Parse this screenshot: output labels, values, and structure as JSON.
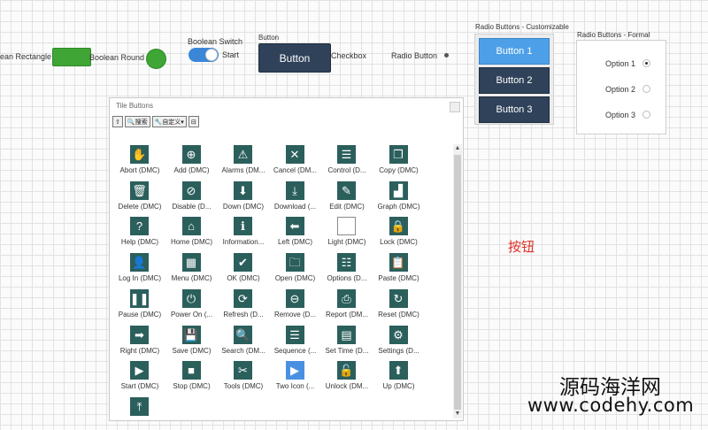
{
  "controls": {
    "boolean_rectangle_label": "ean Rectangle",
    "boolean_round_label": "Boolean Round",
    "boolean_switch_label": "Boolean Switch",
    "boolean_switch_text": "Start",
    "button_caption": "Button",
    "button_label": "Button",
    "checkbox_label": "Checkbox",
    "radio_button_label": "Radio Button"
  },
  "custom_radio": {
    "title": "Radio Buttons - Customizable",
    "options": [
      "Button 1",
      "Button 2",
      "Button 3"
    ],
    "selected_index": 0,
    "colors": {
      "selected": "#4da0e8",
      "normal": "#2f4259"
    }
  },
  "formal_radio": {
    "title": "Radio Buttons - Formal",
    "options": [
      "Option 1",
      "Option 2",
      "Option 3"
    ],
    "selected_index": 0
  },
  "tile_buttons": {
    "title": "Tile Buttons",
    "toolbar": {
      "up": "⇧",
      "search": "搜索",
      "custom": "自定义▾",
      "view": "⊟"
    },
    "tiles": [
      {
        "label": "Abort (DMC)",
        "icon": "hand-icon",
        "glyph": "✋"
      },
      {
        "label": "Add (DMC)",
        "icon": "add-icon",
        "glyph": "⊕"
      },
      {
        "label": "Alarms (DM...",
        "icon": "warning-icon",
        "glyph": "⚠"
      },
      {
        "label": "Cancel (DM...",
        "icon": "close-icon",
        "glyph": "✕"
      },
      {
        "label": "Control (D...",
        "icon": "sliders-icon",
        "glyph": "☰"
      },
      {
        "label": "Copy (DMC)",
        "icon": "copy-icon",
        "glyph": "❐"
      },
      {
        "label": "Delete (DMC)",
        "icon": "trash-icon",
        "glyph": "🗑"
      },
      {
        "label": "Disable (D...",
        "icon": "disable-icon",
        "glyph": "⊘"
      },
      {
        "label": "Down (DMC)",
        "icon": "arrow-down-icon",
        "glyph": "⬇"
      },
      {
        "label": "Download (...",
        "icon": "download-icon",
        "glyph": "⤓"
      },
      {
        "label": "Edit (DMC)",
        "icon": "pencil-icon",
        "glyph": "✎"
      },
      {
        "label": "Graph (DMC)",
        "icon": "bar-chart-icon",
        "glyph": "▟"
      },
      {
        "label": "Help (DMC)",
        "icon": "help-icon",
        "glyph": "?"
      },
      {
        "label": "Home (DMC)",
        "icon": "home-icon",
        "glyph": "⌂"
      },
      {
        "label": "Information...",
        "icon": "info-icon",
        "glyph": "ℹ"
      },
      {
        "label": "Left (DMC)",
        "icon": "arrow-left-icon",
        "glyph": "⬅"
      },
      {
        "label": "Light (DMC)",
        "icon": "light-icon",
        "glyph": ""
      },
      {
        "label": "Lock (DMC)",
        "icon": "lock-icon",
        "glyph": "🔒"
      },
      {
        "label": "Log In (DMC)",
        "icon": "user-icon",
        "glyph": "👤"
      },
      {
        "label": "Menu (DMC)",
        "icon": "menu-grid-icon",
        "glyph": "▦"
      },
      {
        "label": "OK (DMC)",
        "icon": "check-icon",
        "glyph": "✔"
      },
      {
        "label": "Open (DMC)",
        "icon": "folder-icon",
        "glyph": "🗀"
      },
      {
        "label": "Options (D...",
        "icon": "list-icon",
        "glyph": "☷"
      },
      {
        "label": "Paste (DMC)",
        "icon": "clipboard-icon",
        "glyph": "📋"
      },
      {
        "label": "Pause (DMC)",
        "icon": "pause-icon",
        "glyph": "❚❚"
      },
      {
        "label": "Power On (...",
        "icon": "power-icon",
        "glyph": "⏻"
      },
      {
        "label": "Refresh (D...",
        "icon": "refresh-icon",
        "glyph": "⟳"
      },
      {
        "label": "Remove (D...",
        "icon": "remove-icon",
        "glyph": "⊖"
      },
      {
        "label": "Report (DM...",
        "icon": "printer-icon",
        "glyph": "⎙"
      },
      {
        "label": "Reset (DMC)",
        "icon": "reset-icon",
        "glyph": "↻"
      },
      {
        "label": "Right (DMC)",
        "icon": "arrow-right-icon",
        "glyph": "➡"
      },
      {
        "label": "Save (DMC)",
        "icon": "save-icon",
        "glyph": "💾"
      },
      {
        "label": "Search (DM...",
        "icon": "search-icon",
        "glyph": "🔍"
      },
      {
        "label": "Sequence (...",
        "icon": "sequence-icon",
        "glyph": "☰"
      },
      {
        "label": "Set Time (D...",
        "icon": "calendar-icon",
        "glyph": "▤"
      },
      {
        "label": "Settings (D...",
        "icon": "gear-icon",
        "glyph": "⚙"
      },
      {
        "label": "Start (DMC)",
        "icon": "play-icon",
        "glyph": "▶"
      },
      {
        "label": "Stop (DMC)",
        "icon": "stop-icon",
        "glyph": "■"
      },
      {
        "label": "Tools (DMC)",
        "icon": "tools-icon",
        "glyph": "✂"
      },
      {
        "label": "Two Icon (...",
        "icon": "two-icon-icon",
        "glyph": "▶"
      },
      {
        "label": "Unlock (DM...",
        "icon": "unlock-icon",
        "glyph": "🔓"
      },
      {
        "label": "Up (DMC)",
        "icon": "arrow-up-icon",
        "glyph": "⬆"
      },
      {
        "label": "",
        "icon": "upload-icon",
        "glyph": "⤒"
      }
    ]
  },
  "annotation": "按钮",
  "watermark": {
    "line1": "源码海洋网",
    "line2": "www.codehy.com"
  },
  "colors": {
    "tile": "#2b5f5c",
    "tile_alt": "#4a90e2",
    "bool_on": "#3fa535",
    "button": "#2f4259"
  }
}
